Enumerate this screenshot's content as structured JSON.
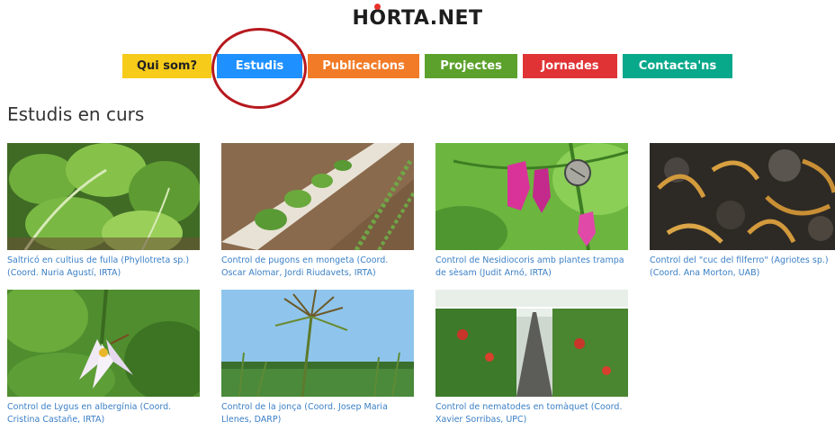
{
  "logo": {
    "pre": "H",
    "o": "O",
    "post": "RTA.NET"
  },
  "nav": {
    "items": [
      {
        "label": "Qui som?"
      },
      {
        "label": "Estudis"
      },
      {
        "label": "Publicacions"
      },
      {
        "label": "Projectes"
      },
      {
        "label": "Jornades"
      },
      {
        "label": "Contacta'ns"
      }
    ]
  },
  "section": {
    "title": "Estudis en curs"
  },
  "cards": [
    {
      "caption": "Saltricó en cultius de fulla (Phyllotreta sp.) (Coord. Nuria Agustí, IRTA)"
    },
    {
      "caption": "Control de pugons en mongeta (Coord. Oscar Alomar, Jordi Riudavets, IRTA)"
    },
    {
      "caption": "Control de Nesidiocoris amb plantes trampa de sèsam (Judit Arnó, IRTA)"
    },
    {
      "caption": "Control del \"cuc del filferro\" (Agriotes sp.) (Coord. Ana Morton, UAB)"
    },
    {
      "caption": "Control de Lygus en albergínia (Coord. Cristina Castañe, IRTA)"
    },
    {
      "caption": "Control de la jonça (Coord. Josep Maria Llenes, DARP)"
    },
    {
      "caption": "Control de nematodes en tomàquet (Coord. Xavier Sorribas, UPC)"
    }
  ],
  "colors": {
    "qui": "#f7cb1a",
    "estudis": "#1e90ff",
    "publicacions": "#f17b27",
    "projectes": "#5ba12c",
    "jornades": "#e03336",
    "contacta": "#08a88b",
    "highlight": "#b7181e",
    "caption": "#3a7fc6"
  }
}
